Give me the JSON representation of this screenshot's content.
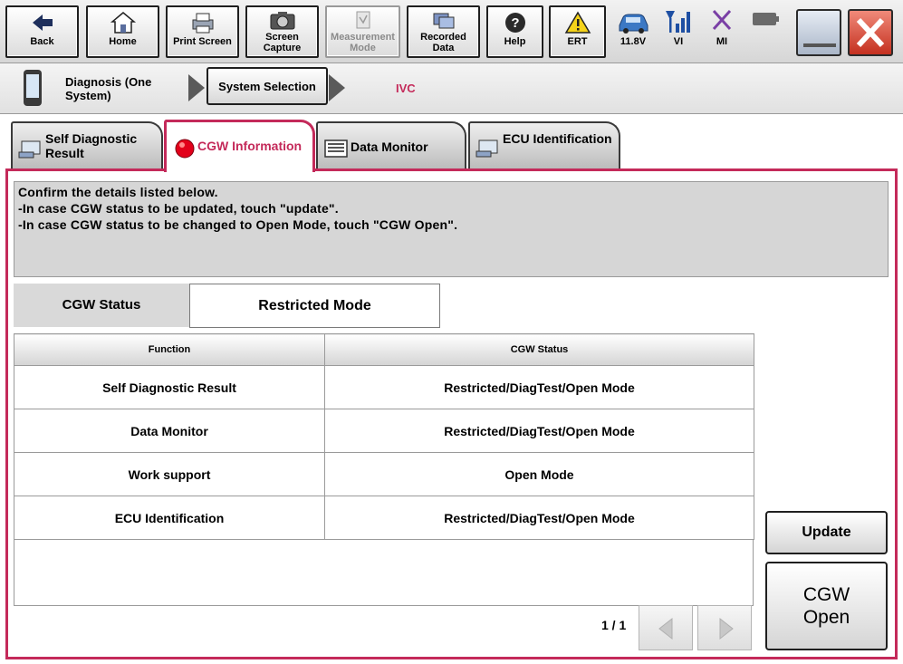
{
  "toolbar": {
    "buttons": [
      {
        "label": "Back",
        "icon": "back-arrow-icon",
        "enabled": true
      },
      {
        "label": "Home",
        "icon": "home-icon",
        "enabled": true
      },
      {
        "label": "Print Screen",
        "icon": "printer-icon",
        "enabled": true
      },
      {
        "label": "Screen Capture",
        "icon": "camera-icon",
        "enabled": true
      },
      {
        "label": "Measurement Mode",
        "icon": "measurement-icon",
        "enabled": false
      },
      {
        "label": "Recorded Data",
        "icon": "recorded-data-icon",
        "enabled": true
      },
      {
        "label": "Help",
        "icon": "help-icon",
        "enabled": true
      },
      {
        "label": "ERT",
        "icon": "warning-icon",
        "enabled": true
      }
    ],
    "status": [
      {
        "label": "11.8V",
        "icon": "car-battery-voltage-icon"
      },
      {
        "label": "VI",
        "icon": "vi-signal-icon"
      },
      {
        "label": "MI",
        "icon": "mi-disconnected-icon"
      },
      {
        "label": "",
        "icon": "battery-icon"
      }
    ]
  },
  "breadcrumb": {
    "diagnosis_label": "Diagnosis (One System)",
    "system_selection_label": "System Selection",
    "current": "IVC"
  },
  "tabs": [
    {
      "label": "Self Diagnostic Result",
      "icon": "self-diagnostic-icon",
      "active": false
    },
    {
      "label": "CGW Information",
      "icon": "red-status-dot-icon",
      "active": true
    },
    {
      "label": "Data Monitor",
      "icon": "data-monitor-icon",
      "active": false
    },
    {
      "label": "ECU Identification",
      "icon": "ecu-id-icon",
      "active": false
    }
  ],
  "message": {
    "lines": [
      "Confirm the details listed below.",
      "-In case CGW status to be updated, touch \"update\".",
      "-In case CGW status to be changed to Open Mode, touch \"CGW Open\"."
    ]
  },
  "cgw_status": {
    "label": "CGW Status",
    "value": "Restricted Mode"
  },
  "table": {
    "headers": [
      "Function",
      "CGW Status"
    ],
    "rows": [
      [
        "Self Diagnostic Result",
        "Restricted/DiagTest/Open Mode"
      ],
      [
        "Data Monitor",
        "Restricted/DiagTest/Open Mode"
      ],
      [
        "Work support",
        "Open Mode"
      ],
      [
        "ECU Identification",
        "Restricted/DiagTest/Open Mode"
      ]
    ]
  },
  "pager": {
    "text": "1 / 1"
  },
  "actions": {
    "update_label": "Update",
    "cgw_open_line1": "CGW",
    "cgw_open_line2": "Open"
  },
  "colors": {
    "accent": "#c42a5a",
    "title_red": "#c42a5a",
    "table_border": "#9a9a9a"
  }
}
